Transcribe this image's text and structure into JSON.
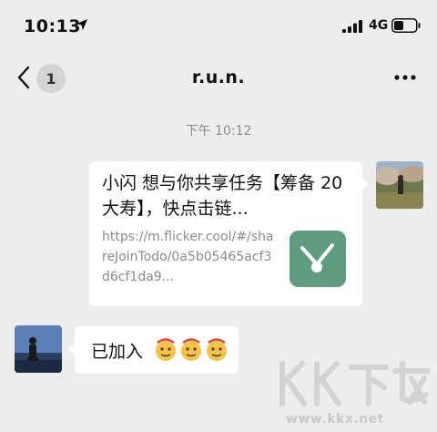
{
  "status_bar": {
    "time": "10:13",
    "network": "4G"
  },
  "nav": {
    "unread_count": "1",
    "title": "r.u.n."
  },
  "chat": {
    "timestamp": "下午 10:12",
    "link_card": {
      "title": "小闪 想与你共享任务【筹备 20大寿】，快点击链...",
      "url": "https://m.flicker.cool/#/shareJoinTodo/0a5b05465acf3d6cf1da9..."
    },
    "reply": {
      "text": "已加入"
    }
  },
  "watermark": {
    "logo_text": "KK下载",
    "url": "www.kkx.net"
  },
  "colors": {
    "background": "#ededed",
    "bubble": "#ffffff",
    "app_icon": "#5f9b7f",
    "timestamp": "#8c8c8c"
  },
  "icons": [
    "location-arrow-icon",
    "signal-icon",
    "battery-icon",
    "back-icon",
    "more-icon",
    "checklist-app-icon",
    "emoji-icon"
  ]
}
